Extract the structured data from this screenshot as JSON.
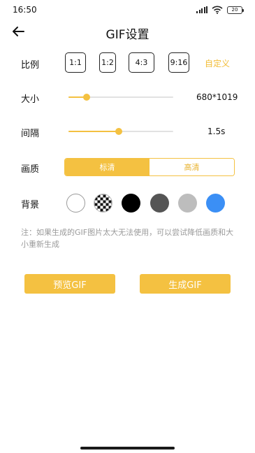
{
  "status_bar": {
    "time": "16:50",
    "battery": "20"
  },
  "header": {
    "title": "GIF设置"
  },
  "ratio": {
    "label": "比例",
    "options": [
      "1:1",
      "1:2",
      "4:3",
      "9:16"
    ],
    "custom": "自定义"
  },
  "size": {
    "label": "大小",
    "value": "680*1019",
    "level": 0.17
  },
  "interval": {
    "label": "间隔",
    "value": "1.5s",
    "level": 0.48
  },
  "quality": {
    "label": "画质",
    "options": [
      "标清",
      "高清"
    ],
    "selected": "标清"
  },
  "background": {
    "label": "背景",
    "swatches": [
      {
        "name": "white",
        "color": "#ffffff"
      },
      {
        "name": "transparent-checker",
        "color": "checker"
      },
      {
        "name": "black",
        "color": "#000000"
      },
      {
        "name": "dark-gray",
        "color": "#555555"
      },
      {
        "name": "light-gray",
        "color": "#bdbdbd"
      },
      {
        "name": "blue",
        "color": "#3b8ff5"
      }
    ]
  },
  "note": "注：如果生成的GIF图片太大无法使用，可以尝试降低画质和大小重新生成",
  "actions": {
    "preview": "预览GIF",
    "generate": "生成GIF"
  },
  "colors": {
    "accent": "#F4C141",
    "accent_text": "#E8B22E",
    "note_text": "#9a9a9a"
  }
}
